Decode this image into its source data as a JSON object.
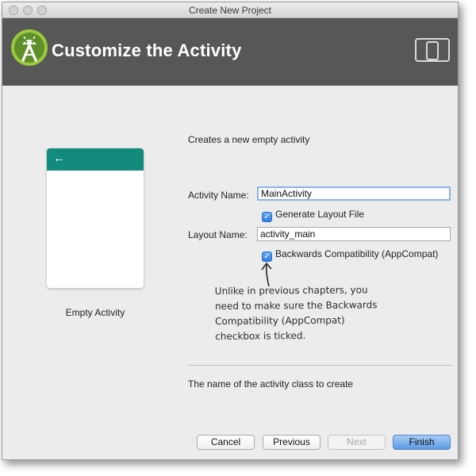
{
  "window": {
    "title": "Create New Project"
  },
  "header": {
    "title": "Customize the Activity",
    "logo_icon": "android-studio-logo-icon",
    "device_icon": "tablet-phone-icon"
  },
  "preview": {
    "caption": "Empty Activity",
    "back_icon": "←"
  },
  "form": {
    "description": "Creates a new empty activity",
    "activity_name_label": "Activity Name:",
    "activity_name_value": "MainActivity",
    "generate_layout_label": "Generate Layout File",
    "generate_layout_checked": true,
    "layout_name_label": "Layout Name:",
    "layout_name_value": "activity_main",
    "backwards_compat_label": "Backwards Compatibility (AppCompat)",
    "backwards_compat_checked": true
  },
  "annotation": {
    "lines": [
      "Unlike in previous chapters, you",
      "need to make sure the Backwards",
      "Compatibility (AppCompat)",
      "checkbox is ticked."
    ]
  },
  "help_text": "The name of the activity class to create",
  "buttons": {
    "cancel": "Cancel",
    "previous": "Previous",
    "next": "Next",
    "finish": "Finish"
  },
  "colors": {
    "header_bg": "#575757",
    "accent_teal": "#128a7c",
    "android_green": "#9bc93b",
    "finish_blue": "#5c9be4"
  }
}
